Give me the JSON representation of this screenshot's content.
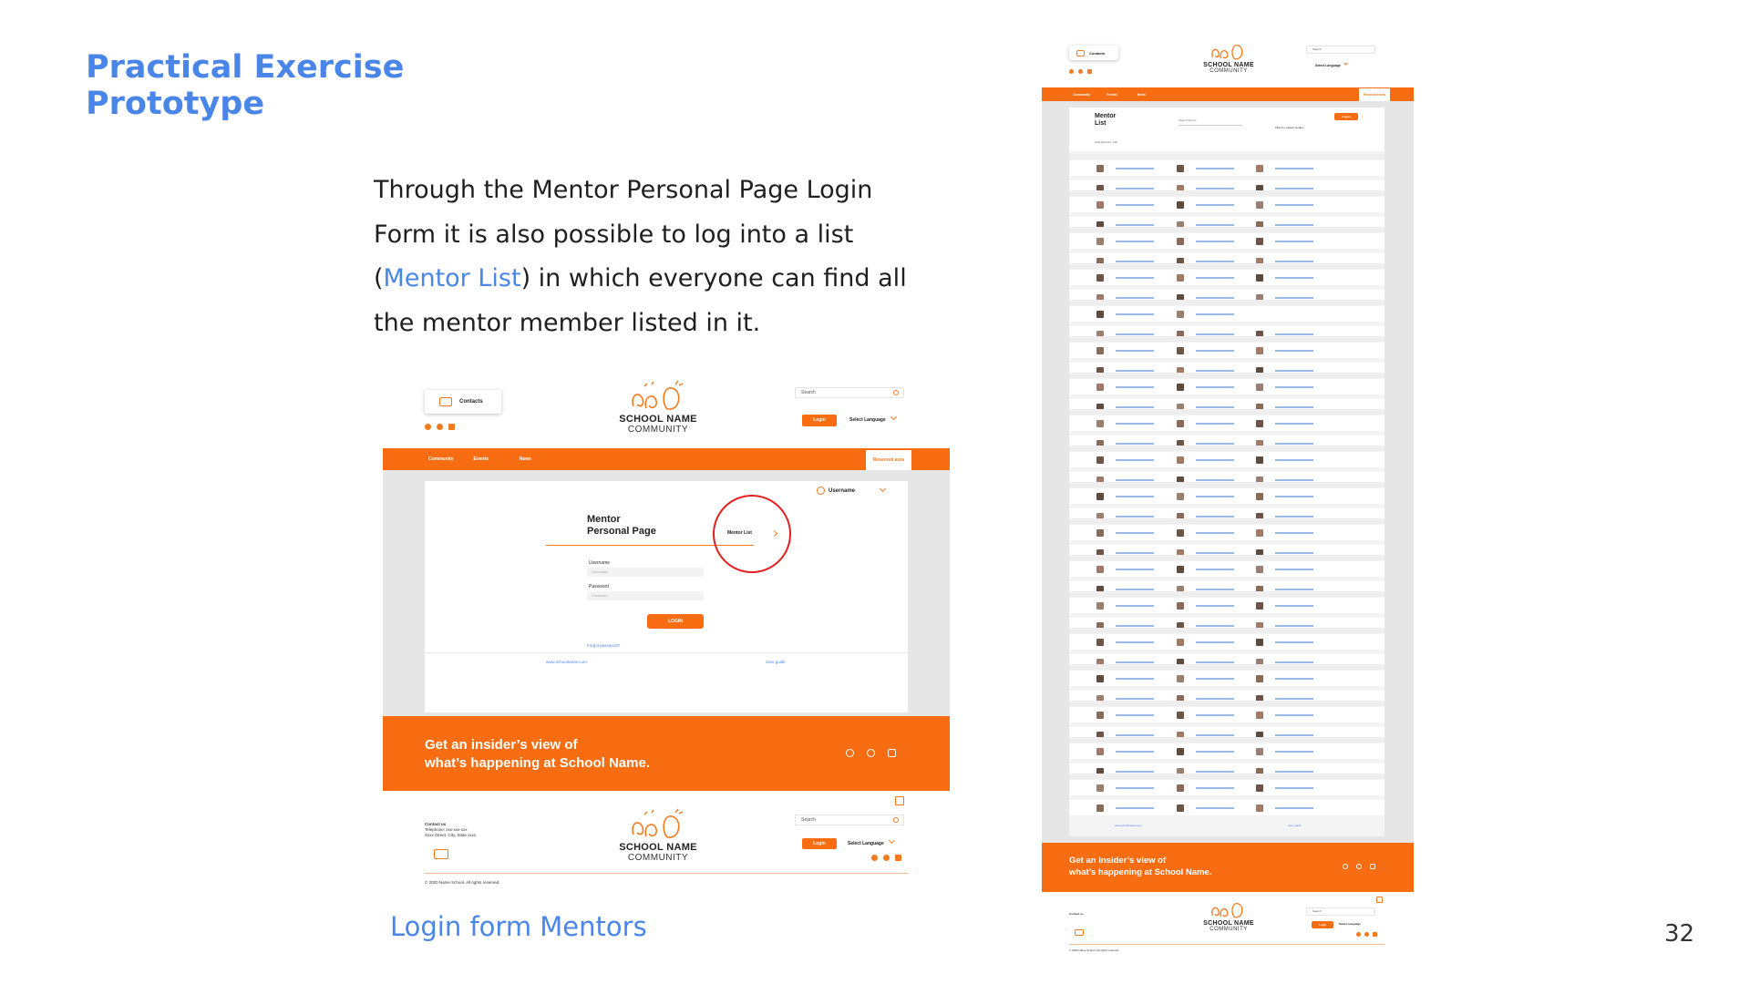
{
  "slide": {
    "title_line1": "Practical Exercise",
    "title_line2": "Prototype",
    "text_before_link": "Through the Mentor Personal Page Login Form it is also possible to log into a list (",
    "text_link": "Mentor List",
    "text_after_link": ") in which everyone can find all the mentor member listed in it.",
    "caption": "Login form Mentors",
    "page_number": "32"
  },
  "mock_login": {
    "contacts_label": "Contacts",
    "logo_line1": "SCHOOL NAME",
    "logo_line2": "COMMUNITY",
    "search_placeholder": "Search",
    "login_label": "Login",
    "language_label": "Select Language",
    "nav": [
      "Community",
      "Events",
      "News"
    ],
    "reserved_area": "Reserved area",
    "username_menu": "Username",
    "card_title_line1": "Mentor",
    "card_title_line2": "Personal Page",
    "mentor_list_link": "Mentor List",
    "username_label": "Username",
    "password_label": "Password",
    "username_placeholder": "Username",
    "password_placeholder": "Password",
    "login_button": "LOGIN",
    "forgot_password": "Forgot password?",
    "site_link": "www.schoolname.com",
    "user_guide": "User guide",
    "banner_line1": "Get an insider’s view of",
    "banner_line2": "what’s happening at School Name.",
    "contact_us": "Contact us",
    "telephone": "Telephone: xxx-xxx-xxx",
    "address": "Xxxx Street, City, State xxxx",
    "copyright": "© 2020 Name School. All rights reserved."
  },
  "mock_list": {
    "contacts_label": "Contacts",
    "logo_line1": "SCHOOL NAME",
    "logo_line2": "COMMUNITY",
    "search_placeholder": "Search",
    "language_label": "Select Language",
    "nav": [
      "Community",
      "Events",
      "News"
    ],
    "reserved_area": "Reserved area",
    "list_title_line1": "Mentor",
    "list_title_line2": "List",
    "search_mentor": "Search Mentor",
    "filter_label": "Filter by subject studies",
    "logout_label": "Logout",
    "total_label": "Total Mentors: 108",
    "site_link": "www.schoolname.com",
    "user_guide": "User guide",
    "banner_line1": "Get an insider’s view of",
    "banner_line2": "what’s happening at School Name.",
    "login_label": "Login",
    "contact_us": "Contact us",
    "copyright": "© 2020 Name School. All rights reserved."
  },
  "colors": {
    "accent_blue": "#4a86e8",
    "brand_orange": "#f86d12",
    "highlight_red": "#e0201f"
  }
}
